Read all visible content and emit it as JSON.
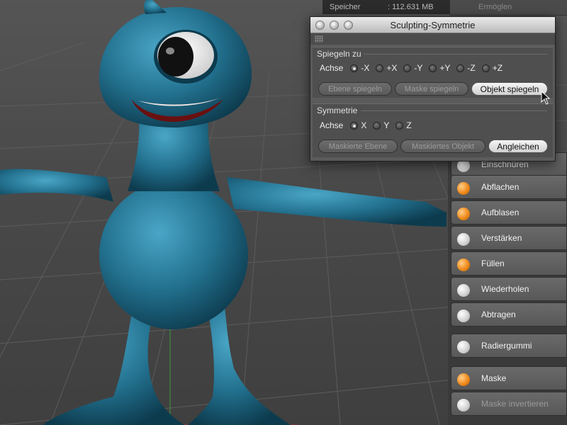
{
  "memory": {
    "label": "Speicher",
    "value": ": 112.631 MB"
  },
  "top_strip_label": "Ermöglen",
  "dialog": {
    "title": "Sculpting-Symmetrie",
    "mirror_section": {
      "title": "Spiegeln zu",
      "axis_label": "Achse",
      "options": [
        "-X",
        "+X",
        "-Y",
        "+Y",
        "-Z",
        "+Z"
      ],
      "selected": "-X",
      "buttons": [
        "Ebene spiegeln",
        "Maske spiegeln",
        "Objekt spiegeln"
      ]
    },
    "symmetry_section": {
      "title": "Symmetrie",
      "axis_label": "Achse",
      "options": [
        "X",
        "Y",
        "Z"
      ],
      "selected": "X",
      "buttons": [
        "Maskierte Ebene",
        "Maskiertes Objekt",
        "Angleichen"
      ]
    }
  },
  "tools": [
    {
      "label": "Einschnüren",
      "icon": "pinch-icon"
    },
    {
      "label": "Abflachen",
      "icon": "flatten-icon"
    },
    {
      "label": "Aufblasen",
      "icon": "inflate-icon"
    },
    {
      "label": "Verstärken",
      "icon": "amplify-icon"
    },
    {
      "label": "Füllen",
      "icon": "fill-icon"
    },
    {
      "label": "Wiederholen",
      "icon": "repeat-icon"
    },
    {
      "label": "Abtragen",
      "icon": "scrape-icon"
    },
    {
      "label": "Radiergummi",
      "icon": "eraser-icon"
    },
    {
      "label": "Maske",
      "icon": "mask-icon"
    },
    {
      "label": "Maske invertieren",
      "icon": "invert-mask-icon"
    }
  ],
  "colors": {
    "creature": "#2a7a9a",
    "dialog_bg": "#5b5b5b",
    "accent_orange": "#f08a1c"
  }
}
